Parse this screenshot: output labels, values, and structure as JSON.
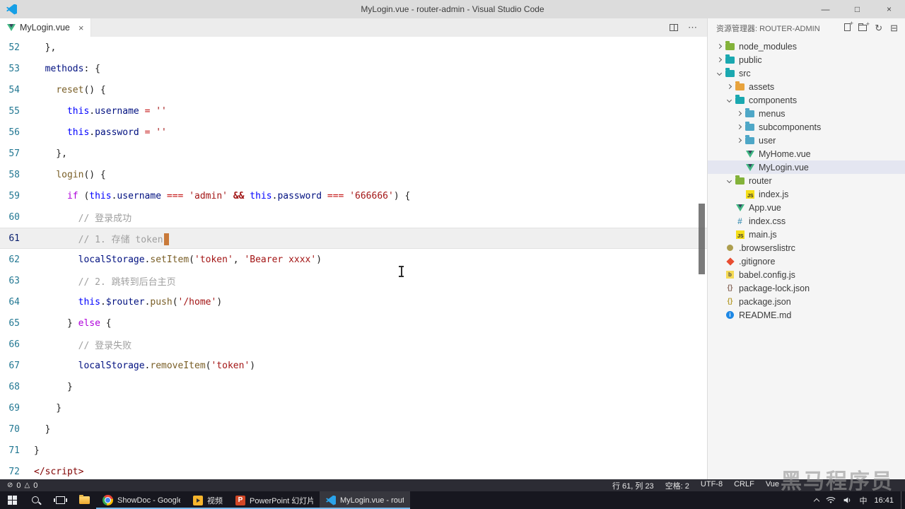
{
  "icons": {
    "minimize": "—",
    "maximize": "□",
    "window_close": "×",
    "tab_close": "×",
    "more": "⋯",
    "refresh": "↻",
    "collapse": "⊟"
  },
  "title_bar": {
    "title": "MyLogin.vue - router-admin - Visual Studio Code"
  },
  "tab_bar": {
    "tabs": [
      {
        "label": "MyLogin.vue"
      }
    ]
  },
  "editor": {
    "cursor_line": 61,
    "lines": [
      {
        "num": "52",
        "tokens": [
          [
            "p",
            "  },"
          ]
        ]
      },
      {
        "num": "53",
        "tokens": [
          [
            "p",
            "  "
          ],
          [
            "prop",
            "methods"
          ],
          [
            "p",
            ": {"
          ]
        ]
      },
      {
        "num": "54",
        "tokens": [
          [
            "p",
            "    "
          ],
          [
            "fn",
            "reset"
          ],
          [
            "p",
            "() {"
          ]
        ]
      },
      {
        "num": "55",
        "tokens": [
          [
            "p",
            "      "
          ],
          [
            "this",
            "this"
          ],
          [
            "p",
            "."
          ],
          [
            "prop",
            "username"
          ],
          [
            "p",
            " "
          ],
          [
            "op",
            "="
          ],
          [
            "p",
            " "
          ],
          [
            "str",
            "''"
          ]
        ]
      },
      {
        "num": "56",
        "tokens": [
          [
            "p",
            "      "
          ],
          [
            "this",
            "this"
          ],
          [
            "p",
            "."
          ],
          [
            "prop",
            "password"
          ],
          [
            "p",
            " "
          ],
          [
            "op",
            "="
          ],
          [
            "p",
            " "
          ],
          [
            "str",
            "''"
          ]
        ]
      },
      {
        "num": "57",
        "tokens": [
          [
            "p",
            "    },"
          ]
        ]
      },
      {
        "num": "58",
        "tokens": [
          [
            "p",
            "    "
          ],
          [
            "fn",
            "login"
          ],
          [
            "p",
            "() {"
          ]
        ]
      },
      {
        "num": "59",
        "tokens": [
          [
            "p",
            "      "
          ],
          [
            "kw",
            "if"
          ],
          [
            "p",
            " ("
          ],
          [
            "this",
            "this"
          ],
          [
            "p",
            "."
          ],
          [
            "prop",
            "username"
          ],
          [
            "p",
            " "
          ],
          [
            "op",
            "==="
          ],
          [
            "p",
            " "
          ],
          [
            "str",
            "'admin'"
          ],
          [
            "p",
            " "
          ],
          [
            "opb",
            "&&"
          ],
          [
            "p",
            " "
          ],
          [
            "this",
            "this"
          ],
          [
            "p",
            "."
          ],
          [
            "prop",
            "password"
          ],
          [
            "p",
            " "
          ],
          [
            "op",
            "==="
          ],
          [
            "p",
            " "
          ],
          [
            "str",
            "'666666'"
          ],
          [
            "p",
            ") {"
          ]
        ]
      },
      {
        "num": "60",
        "tokens": [
          [
            "cmt",
            "        // 登录成功"
          ]
        ]
      },
      {
        "num": "61",
        "tokens": [
          [
            "cmt",
            "        // 1. 存储 token"
          ],
          [
            "cursor",
            ""
          ]
        ]
      },
      {
        "num": "62",
        "tokens": [
          [
            "p",
            "        "
          ],
          [
            "obj",
            "localStorage"
          ],
          [
            "p",
            "."
          ],
          [
            "fn",
            "setItem"
          ],
          [
            "p",
            "("
          ],
          [
            "str",
            "'token'"
          ],
          [
            "p",
            ", "
          ],
          [
            "str",
            "'Bearer xxxx'"
          ],
          [
            "p",
            ")"
          ]
        ]
      },
      {
        "num": "63",
        "tokens": [
          [
            "cmt",
            "        // 2. 跳转到后台主页"
          ]
        ]
      },
      {
        "num": "64",
        "tokens": [
          [
            "p",
            "        "
          ],
          [
            "this",
            "this"
          ],
          [
            "p",
            "."
          ],
          [
            "prop",
            "$router"
          ],
          [
            "p",
            "."
          ],
          [
            "fn",
            "push"
          ],
          [
            "p",
            "("
          ],
          [
            "str",
            "'/home'"
          ],
          [
            "p",
            ")"
          ]
        ]
      },
      {
        "num": "65",
        "tokens": [
          [
            "p",
            "      } "
          ],
          [
            "kw",
            "else"
          ],
          [
            "p",
            " {"
          ]
        ]
      },
      {
        "num": "66",
        "tokens": [
          [
            "cmt",
            "        // 登录失败"
          ]
        ]
      },
      {
        "num": "67",
        "tokens": [
          [
            "p",
            "        "
          ],
          [
            "obj",
            "localStorage"
          ],
          [
            "p",
            "."
          ],
          [
            "fn",
            "removeItem"
          ],
          [
            "p",
            "("
          ],
          [
            "str",
            "'token'"
          ],
          [
            "p",
            ")"
          ]
        ]
      },
      {
        "num": "68",
        "tokens": [
          [
            "p",
            "      }"
          ]
        ]
      },
      {
        "num": "69",
        "tokens": [
          [
            "p",
            "    }"
          ]
        ]
      },
      {
        "num": "70",
        "tokens": [
          [
            "p",
            "  }"
          ]
        ]
      },
      {
        "num": "71",
        "tokens": [
          [
            "p",
            "}"
          ]
        ]
      },
      {
        "num": "72",
        "tokens": [
          [
            "tag",
            "</script>"
          ]
        ]
      }
    ]
  },
  "sidebar": {
    "title": "资源管理器: ROUTER-ADMIN",
    "items": [
      {
        "label": "node_modules",
        "level": 0,
        "chevron": "right",
        "icon": "folder",
        "color": "#83b23a"
      },
      {
        "label": "public",
        "level": 0,
        "chevron": "right",
        "icon": "folder",
        "color": "#1aa8b0"
      },
      {
        "label": "src",
        "level": 0,
        "chevron": "down",
        "icon": "folder",
        "color": "#1aa8b0"
      },
      {
        "label": "assets",
        "level": 1,
        "chevron": "right",
        "icon": "folder",
        "color": "#e8a33d"
      },
      {
        "label": "components",
        "level": 1,
        "chevron": "down",
        "icon": "folder",
        "color": "#1aa8b0"
      },
      {
        "label": "menus",
        "level": 2,
        "chevron": "right",
        "icon": "folder",
        "color": "#4ea7c7"
      },
      {
        "label": "subcomponents",
        "level": 2,
        "chevron": "right",
        "icon": "folder",
        "color": "#4ea7c7"
      },
      {
        "label": "user",
        "level": 2,
        "chevron": "right",
        "icon": "folder",
        "color": "#4ea7c7"
      },
      {
        "label": "MyHome.vue",
        "level": 2,
        "chevron": "none",
        "icon": "vue"
      },
      {
        "label": "MyLogin.vue",
        "level": 2,
        "chevron": "none",
        "icon": "vue",
        "selected": true
      },
      {
        "label": "router",
        "level": 1,
        "chevron": "down",
        "icon": "folder",
        "color": "#83b23a"
      },
      {
        "label": "index.js",
        "level": 2,
        "chevron": "none",
        "icon": "js"
      },
      {
        "label": "App.vue",
        "level": 1,
        "chevron": "none",
        "icon": "vue"
      },
      {
        "label": "index.css",
        "level": 1,
        "chevron": "none",
        "icon": "css"
      },
      {
        "label": "main.js",
        "level": 1,
        "chevron": "none",
        "icon": "js"
      },
      {
        "label": ".browserslistrc",
        "level": 0,
        "chevron": "none",
        "icon": "dot",
        "color": "#ad9e4e"
      },
      {
        "label": ".gitignore",
        "level": 0,
        "chevron": "none",
        "icon": "git",
        "color": "#e84d31"
      },
      {
        "label": "babel.config.js",
        "level": 0,
        "chevron": "none",
        "icon": "babel",
        "color": "#f5da55"
      },
      {
        "label": "package-lock.json",
        "level": 0,
        "chevron": "none",
        "icon": "json",
        "color": "#8d6e63"
      },
      {
        "label": "package.json",
        "level": 0,
        "chevron": "none",
        "icon": "json",
        "color": "#b8a038"
      },
      {
        "label": "README.md",
        "level": 0,
        "chevron": "none",
        "icon": "info",
        "color": "#1e88e5"
      }
    ]
  },
  "status_bar": {
    "errors": "0",
    "warnings": "0",
    "right": [
      "行 61, 列 23",
      "空格: 2",
      "UTF-8",
      "CRLF",
      "Vue"
    ]
  },
  "watermark": {
    "text": "黑马程序员"
  },
  "taskbar": {
    "apps": [
      {
        "id": "chrome",
        "label": "ShowDoc - Google ..."
      },
      {
        "id": "video",
        "label": "视频"
      },
      {
        "id": "powerpoint",
        "label": "PowerPoint 幻灯片..."
      },
      {
        "id": "vscode",
        "label": "MyLogin.vue - rout...",
        "active": true
      }
    ],
    "tray": {
      "ime": "中",
      "time": "16:41"
    }
  },
  "colors": {
    "accent": "#0078d7",
    "vue_green": "#41b883",
    "cursor": "#c97a3a"
  }
}
